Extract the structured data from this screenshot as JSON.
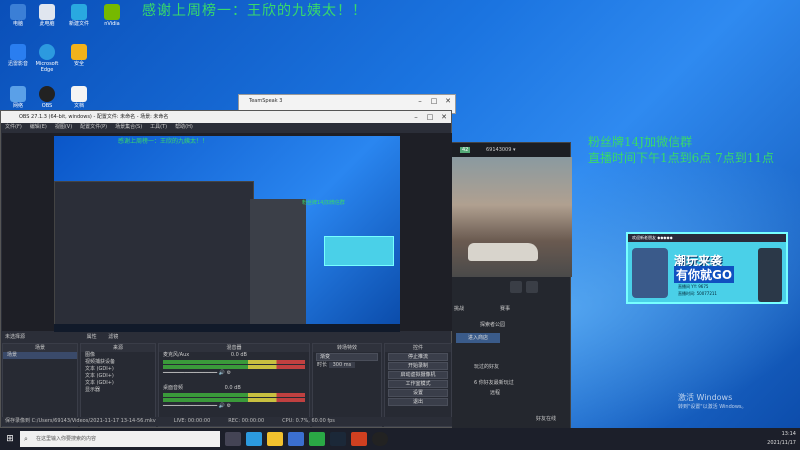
{
  "desktop": {
    "icons": [
      {
        "label": "电脑",
        "color": "#3b7fd6"
      },
      {
        "label": "此电脑",
        "color": "#e0e6ef"
      },
      {
        "label": "新建文件",
        "color": "#29a9e0"
      },
      {
        "label": "nVidia",
        "color": "#76b900"
      },
      {
        "label": "迅雷影音",
        "color": "#2a7ef0"
      },
      {
        "label": "Microsoft Edge",
        "color": "#2c9adf"
      },
      {
        "label": "安全",
        "color": "#f2b21b"
      },
      {
        "label": "网络",
        "color": "#5aa0e8"
      },
      {
        "label": "OBS",
        "color": "#222"
      },
      {
        "label": "文档",
        "color": "#f4f4f4"
      }
    ],
    "overlay_title": "感谢上周榜一：王欣的九姨太！！",
    "overlay_side": [
      "粉丝牌14J加微信群",
      "直播时间下午1点到6点 7点到11点"
    ],
    "banner": {
      "top": "欢迎新老朋友 ◆◆◆◆◆",
      "big1": "潮玩来袭",
      "big2": "有你就GO",
      "line1": "直播间 YY: 9675",
      "line2": "直播时间: 50077211"
    },
    "activate": {
      "title": "激活 Windows",
      "sub": "转到\"设置\"以激活 Windows。"
    }
  },
  "teamspeak": {
    "title": "TeamSpeak 3"
  },
  "obs": {
    "title": "OBS 27.1.3 (64-bit, windows) - 配置文件: 未命名 - 场景: 未命名",
    "menu": [
      "文件(F)",
      "编辑(E)",
      "视图(V)",
      "配置文件(P)",
      "场景集合(S)",
      "工具(T)",
      "帮助(H)"
    ],
    "nested_text": "感谢上周榜一：王欣的九姨太！！",
    "nested_side": "粉丝牌14J加微信群",
    "no_source": "未选择源",
    "properties_label": "属性",
    "filters_label": "滤镜",
    "scenes": {
      "header": "场景",
      "items": [
        "场景"
      ]
    },
    "sources": {
      "header": "来源",
      "items": [
        "图像",
        "视频捕获设备",
        "文本 (GDI+)",
        "文本 (GDI+)",
        "文本 (GDI+)",
        "显示器"
      ]
    },
    "mixer": {
      "header": "混音器",
      "ch1": "麦克风/Aux",
      "ch1_db": "0.0 dB",
      "ch2": "桌面音频",
      "ch2_db": "0.0 dB"
    },
    "transitions": {
      "header": "转场特效",
      "type": "渐变",
      "duration_label": "时长",
      "duration": "300 ms"
    },
    "controls": {
      "header": "控件",
      "buttons": [
        "停止推流",
        "开始录制",
        "启动虚拟摄像机",
        "工作室模式",
        "设置",
        "退出"
      ]
    },
    "status": {
      "path": "保存录像到 C:/Users/69143/Videos/2021-11-17 13-14-56.mkv",
      "live": "LIVE: 00:00:00",
      "rec": "REC: 00:00:00",
      "cpu": "CPU: 0.7%, 60.00 fps"
    }
  },
  "game": {
    "tab": "69143009 ▾",
    "level": "42",
    "items": [
      "挑战",
      "赛事",
      "探索者公园",
      "玩过的好友",
      "6 你好友最新玩过",
      "远程",
      "好友在线"
    ],
    "pill": "进入商店"
  },
  "taskbar": {
    "search_placeholder": "在这里输入你要搜索的内容",
    "time": "13:14",
    "date": "2021/11/17"
  }
}
